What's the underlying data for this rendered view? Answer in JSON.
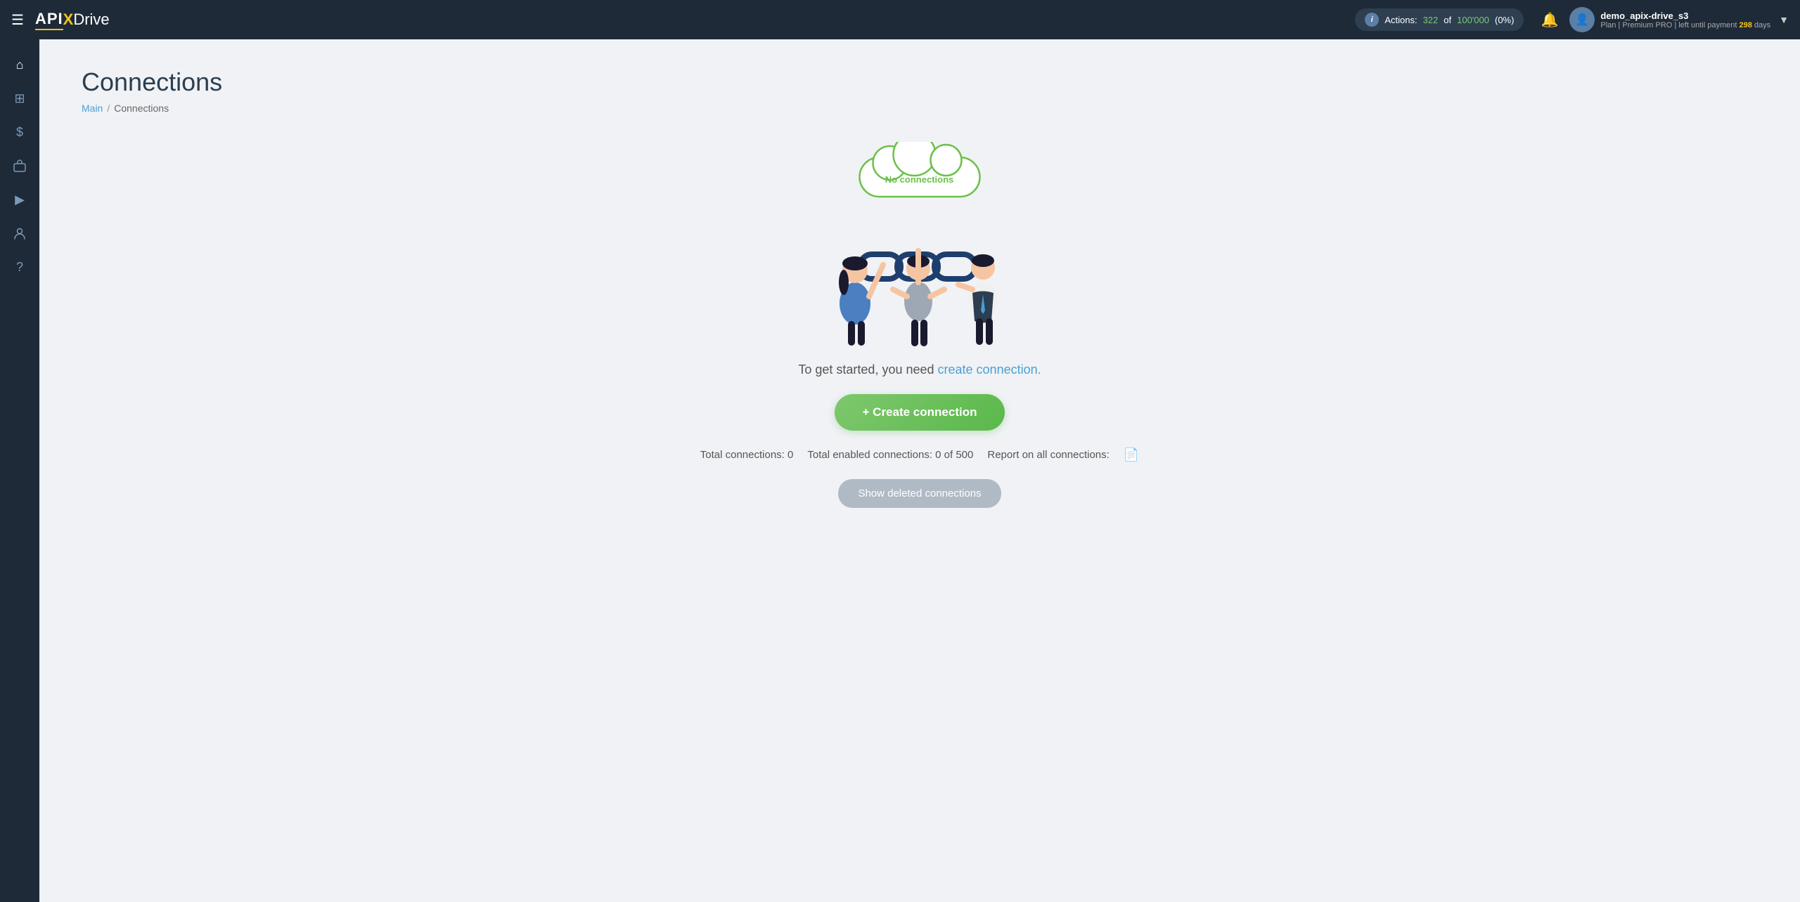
{
  "topnav": {
    "logo": {
      "api": "API",
      "x": "X",
      "drive": "Drive"
    },
    "actions": {
      "label": "Actions:",
      "current": "322",
      "total": "100'000",
      "percent": "(0%)"
    },
    "user": {
      "name": "demo_apix-drive_s3",
      "plan_prefix": "Plan |",
      "plan_name": "Premium PRO",
      "plan_suffix": "| left until payment",
      "days": "298",
      "days_suffix": "days"
    }
  },
  "sidebar": {
    "items": [
      {
        "name": "home",
        "icon": "⌂"
      },
      {
        "name": "connections",
        "icon": "⊞"
      },
      {
        "name": "billing",
        "icon": "$"
      },
      {
        "name": "briefcase",
        "icon": "⊡"
      },
      {
        "name": "youtube",
        "icon": "▶"
      },
      {
        "name": "profile",
        "icon": "○"
      },
      {
        "name": "help",
        "icon": "?"
      }
    ]
  },
  "page": {
    "title": "Connections",
    "breadcrumb_main": "Main",
    "breadcrumb_current": "Connections"
  },
  "empty_state": {
    "cloud_text": "No connections",
    "cta_prefix": "To get started, you need ",
    "cta_link": "create connection.",
    "create_button": "+ Create connection",
    "stats_total_label": "Total connections: 0",
    "stats_enabled_label": "Total enabled connections: 0 of 500",
    "stats_report_label": "Report on all connections:",
    "show_deleted": "Show deleted connections"
  }
}
